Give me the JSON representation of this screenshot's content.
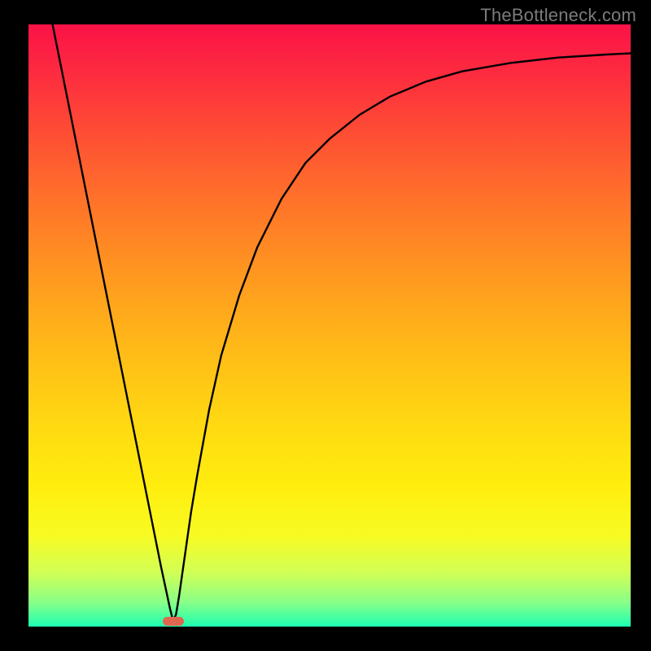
{
  "watermark": "TheBottleneck.com",
  "chart_data": {
    "type": "line",
    "title": "",
    "xlabel": "",
    "ylabel": "",
    "xlim": [
      0,
      100
    ],
    "ylim": [
      0,
      100
    ],
    "grid": false,
    "legend": false,
    "x": [
      4,
      6,
      8,
      10,
      12,
      14,
      16,
      18,
      20,
      22,
      23.5,
      24,
      24.5,
      25,
      26,
      27,
      28,
      30,
      32,
      35,
      38,
      42,
      46,
      50,
      55,
      60,
      66,
      72,
      80,
      88,
      96,
      100
    ],
    "y": [
      100,
      90,
      80,
      70,
      60,
      50,
      40,
      30,
      20,
      10,
      3,
      1,
      2,
      5,
      12,
      19,
      25,
      36,
      45,
      55,
      63,
      71,
      77,
      81,
      85,
      88,
      90.5,
      92.2,
      93.6,
      94.5,
      95.0,
      95.2
    ],
    "marker": {
      "x": 24,
      "y": 1
    }
  },
  "colors": {
    "curve": "#000000",
    "marker": "#e06650",
    "frame": "#000000"
  }
}
